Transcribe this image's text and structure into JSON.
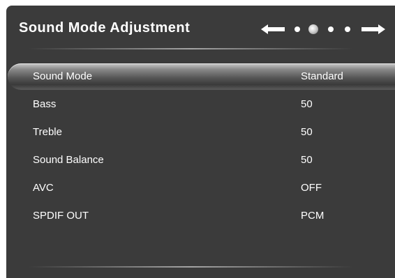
{
  "header": {
    "title": "Sound Mode Adjustment",
    "pager": {
      "left_icon": "arrow-left-icon",
      "right_icon": "arrow-right-icon",
      "dot_count": 4,
      "active_index": 1
    }
  },
  "menu": {
    "selected_index": 0,
    "items": [
      {
        "label": "Sound Mode",
        "value": "Standard"
      },
      {
        "label": "Bass",
        "value": "50"
      },
      {
        "label": "Treble",
        "value": "50"
      },
      {
        "label": "Sound Balance",
        "value": "50"
      },
      {
        "label": "AVC",
        "value": "OFF"
      },
      {
        "label": "SPDIF OUT",
        "value": "PCM"
      }
    ]
  },
  "colors": {
    "panel_bg": "#3b3b3b",
    "text": "#ffffff",
    "highlight": "#8a8a8a"
  }
}
